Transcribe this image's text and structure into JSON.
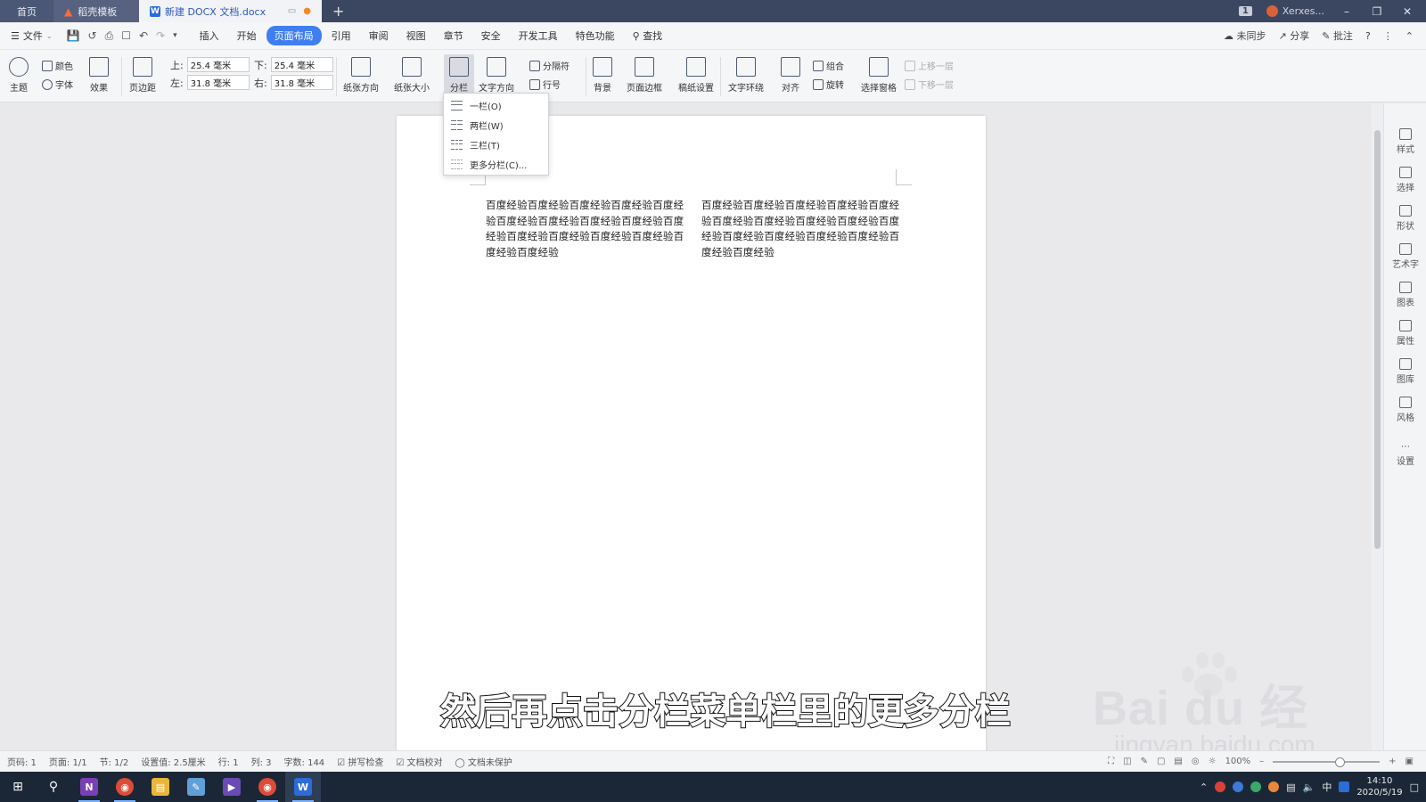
{
  "tabs": [
    {
      "label": "首页"
    },
    {
      "label": "稻壳模板"
    },
    {
      "label": "新建 DOCX 文档.docx"
    }
  ],
  "title_right": {
    "window_count": "1",
    "user": "Xerxes..."
  },
  "menubar": {
    "file_label": "文件",
    "items": [
      "插入",
      "开始",
      "页面布局",
      "引用",
      "审阅",
      "视图",
      "章节",
      "安全",
      "开发工具",
      "特色功能"
    ],
    "active": "页面布局",
    "search_label": "查找",
    "sync_label": "未同步",
    "share_label": "分享",
    "comment_label": "批注"
  },
  "ribbon": {
    "theme": "主题",
    "color": "颜色",
    "font": "字体",
    "effect": "效果",
    "margins": "页边距",
    "top_label": "上:",
    "top_value": "25.4 毫米",
    "bottom_label": "下:",
    "bottom_value": "25.4 毫米",
    "left_label": "左:",
    "left_value": "31.8 毫米",
    "right_label": "右:",
    "right_value": "31.8 毫米",
    "orientation": "纸张方向",
    "size": "纸张大小",
    "columns": "分栏",
    "text_direction": "文字方向",
    "separator": "分隔符",
    "line_number": "行号",
    "background": "背景",
    "page_border": "页面边框",
    "manuscript": "稿纸设置",
    "wrap": "文字环绕",
    "align": "对齐",
    "group": "组合",
    "rotate": "旋转",
    "selection_pane": "选择窗格",
    "bring_forward": "上移一层",
    "send_backward": "下移一层"
  },
  "columns_menu": {
    "items": [
      "一栏(O)",
      "两栏(W)",
      "三栏(T)",
      "更多分栏(C)..."
    ]
  },
  "document": {
    "col1": "百度经验百度经验百度经验百度经验百度经验百度经验百度经验百度经验百度经验百度经验百度经验百度经验百度经验百度经验百度经验百度经验",
    "col2": "百度经验百度经验百度经验百度经验百度经验百度经验百度经验百度经验百度经验百度经验百度经验百度经验百度经验百度经验百度经验百度经验"
  },
  "subtitle": "然后再点击分栏菜单栏里的更多分栏",
  "watermark": {
    "logo": "Bai  du 经验",
    "url": "jingyan.baidu.com"
  },
  "sidebar": [
    "样式",
    "选择",
    "形状",
    "艺术字",
    "图表",
    "属性",
    "图库",
    "风格",
    "设置"
  ],
  "statusbar": {
    "page_num": "页码: 1",
    "pages": "页面: 1/1",
    "section": "节: 1/2",
    "setting": "设置值: 2.5厘米",
    "row": "行: 1",
    "col": "列: 3",
    "words": "字数: 144",
    "spell": "拼写检查",
    "proof": "文档校对",
    "protect": "文档未保护",
    "zoom": "100%"
  },
  "taskbar": {
    "time": "14:10",
    "date": "2020/5/19",
    "ime": "中"
  },
  "colors": {
    "accent": "#3f7ef0",
    "titlebar": "#3b4660",
    "taskbar": "#1b2736"
  }
}
